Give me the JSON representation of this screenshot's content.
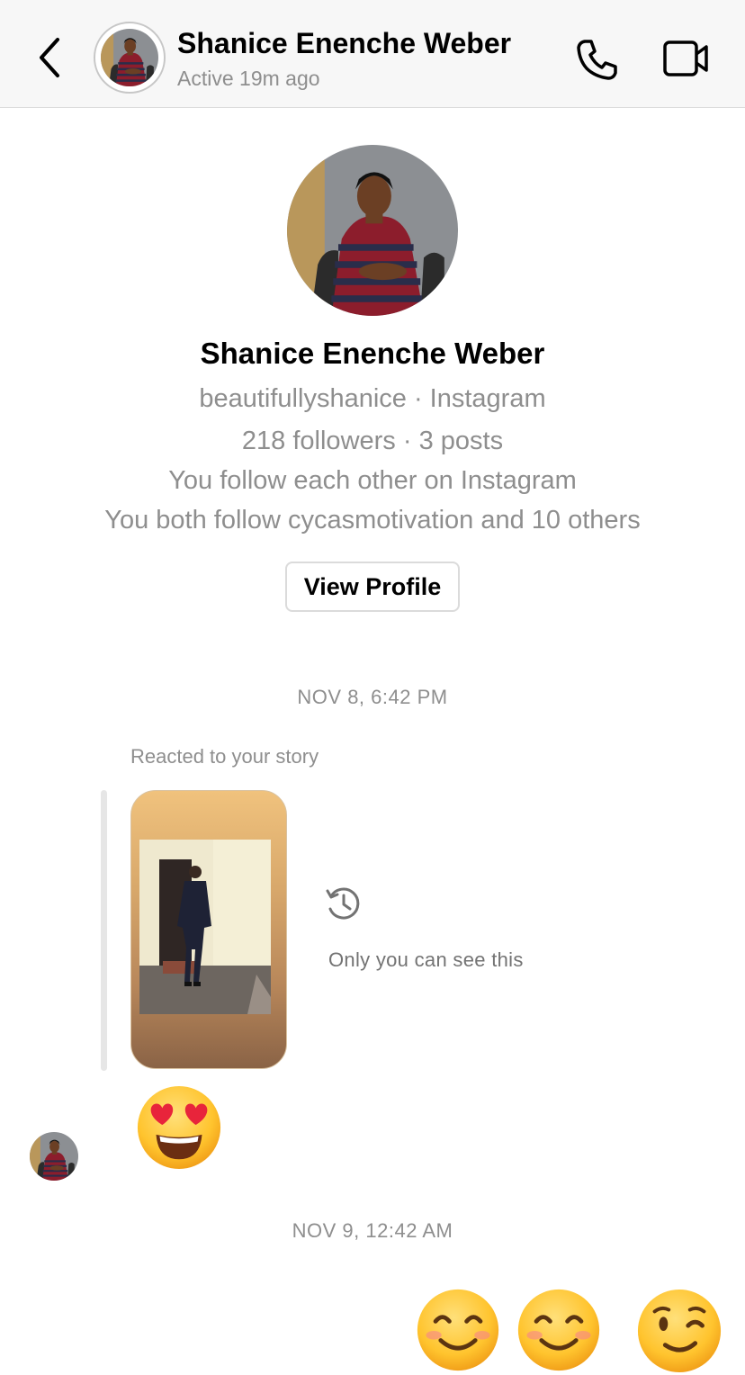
{
  "header": {
    "name": "Shanice Enenche Weber",
    "status": "Active 19m ago",
    "back_icon": "chevron-left-icon",
    "call_icon": "phone-icon",
    "video_icon": "video-camera-icon"
  },
  "profile": {
    "name": "Shanice Enenche Weber",
    "handle_line": "beautifullyshanice · Instagram",
    "stats_line": "218 followers · 3 posts",
    "mutual_line": "You follow each other on Instagram",
    "common_line": "You both follow cycasmotivation and 10 others",
    "view_profile_label": "View Profile"
  },
  "thread": {
    "timestamp_1": "NOV 8, 6:42 PM",
    "story_reply_label": "Reacted to your story",
    "story_privacy_note": "Only you can see this",
    "story_privacy_icon": "history-clock-icon",
    "reaction_emoji": "heart-eyes-emoji",
    "timestamp_2": "NOV 9, 12:42 AM",
    "sent_emojis": [
      "smiling-eyes-emoji",
      "smiling-eyes-emoji",
      "winking-emoji"
    ]
  },
  "colors": {
    "header_bg": "#f7f7f7",
    "secondary_text": "#8e8e8e",
    "border": "#dbdbdb",
    "emoji_yellow": "#ffcc33",
    "heart_red": "#e8243b"
  }
}
